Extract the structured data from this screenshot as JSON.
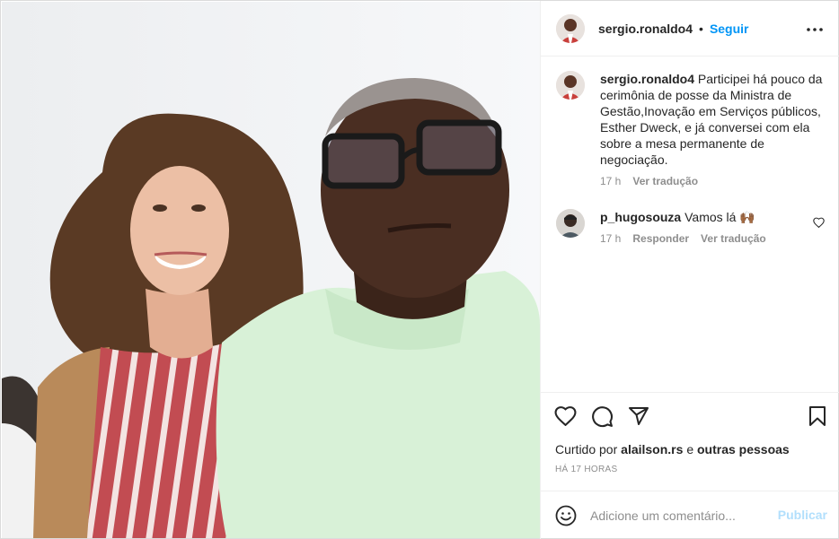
{
  "post": {
    "username": "sergio.ronaldo4",
    "separator": "•",
    "follow_label": "Seguir",
    "caption": {
      "username": "sergio.ronaldo4",
      "text": "Participei há pouco da cerimônia de posse da Ministra de Gestão,Inovação em Serviços públicos, Esther Dweck, e já conversei com ela sobre a mesa permanente de negociação.",
      "age": "17 h",
      "translate_label": "Ver tradução"
    },
    "comments": [
      {
        "username": "p_hugosouza",
        "text": "Vamos lá 🙌🏾",
        "age": "17 h",
        "reply_label": "Responder",
        "translate_label": "Ver tradução"
      }
    ],
    "likes": {
      "prefix": "Curtido por",
      "user": "alailson.rs",
      "conjunction": "e",
      "others": "outras pessoas"
    },
    "timestamp": "HÁ 17 HORAS",
    "add_comment": {
      "placeholder": "Adicione um comentário...",
      "publish_label": "Publicar"
    }
  },
  "colors": {
    "accent": "#0095f6",
    "publish_disabled": "#b2dffc",
    "text": "#262626",
    "secondary": "#8e8e8e",
    "border": "#efefef"
  },
  "icons": [
    "more-icon",
    "heart-icon",
    "comment-icon",
    "share-icon",
    "save-icon",
    "emoji-icon",
    "small-heart-icon"
  ]
}
